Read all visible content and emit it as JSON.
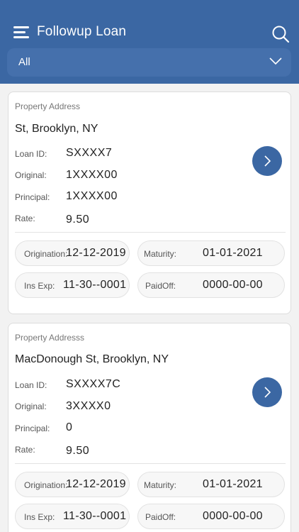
{
  "header": {
    "title": "Followup Loan"
  },
  "filter": {
    "selected": "All"
  },
  "loans": [
    {
      "address_label": "Property Address",
      "address": "St, Brooklyn, NY",
      "loan_id_label": "Loan ID:",
      "loan_id": "SXXXX7",
      "original_label": "Original:",
      "original": "1XXXX00",
      "principal_label": "Principal:",
      "principal": "1XXXX00",
      "rate_label": "Rate:",
      "rate": "9.50",
      "origination_label": "Origination:",
      "origination": "12-12-2019",
      "maturity_label": "Maturity:",
      "maturity": "01-01-2021",
      "ins_exp_label": "Ins Exp:",
      "ins_exp": "11-30--0001",
      "paidoff_label": "PaidOff:",
      "paidoff": "0000-00-00"
    },
    {
      "address_label": "Property Addresss",
      "address": "MacDonough St, Brooklyn, NY",
      "loan_id_label": "Loan ID:",
      "loan_id": "SXXXX7C",
      "original_label": "Original:",
      "original": "3XXXX0",
      "principal_label": "Principal:",
      "principal": "0",
      "rate_label": "Rate:",
      "rate": "9.50",
      "origination_label": "Origination:",
      "origination": "12-12-2019",
      "maturity_label": "Maturity:",
      "maturity": "01-01-2021",
      "ins_exp_label": "Ins Exp:",
      "ins_exp": "11-30--0001",
      "paidoff_label": "PaidOff:",
      "paidoff": "0000-00-00"
    }
  ],
  "colors": {
    "brand": "#3b67a3",
    "background": "#f2f2f2"
  },
  "icons": [
    "menu-icon",
    "search-icon",
    "chevron-down-icon",
    "chevron-right-icon"
  ]
}
